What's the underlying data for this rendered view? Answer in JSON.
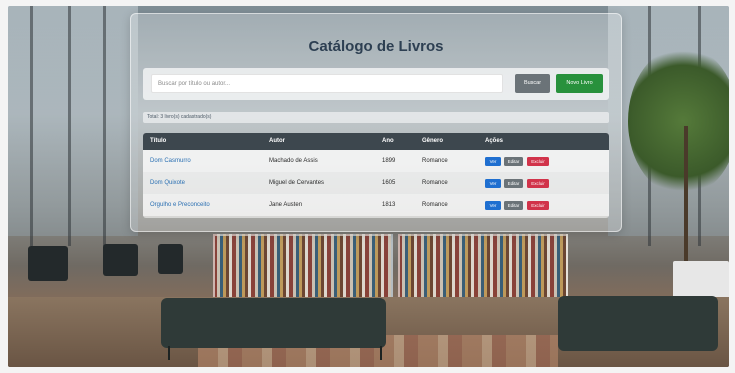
{
  "app": {
    "title": "Catálogo de Livros"
  },
  "search": {
    "placeholder": "Buscar por título ou autor...",
    "buscar_label": "Buscar",
    "novo_label": "Novo Livro"
  },
  "summary": {
    "total_text": "Total: 3 livro(s) cadastrado(s)"
  },
  "table": {
    "headers": [
      "Título",
      "Autor",
      "Ano",
      "Gênero",
      "Ações"
    ],
    "rows": [
      {
        "titulo": "Dom Casmurro",
        "autor": "Machado de Assis",
        "ano": "1899",
        "genero": "Romance"
      },
      {
        "titulo": "Dom Quixote",
        "autor": "Miguel de Cervantes",
        "ano": "1605",
        "genero": "Romance"
      },
      {
        "titulo": "Orgulho e Preconceito",
        "autor": "Jane Austen",
        "ano": "1813",
        "genero": "Romance"
      }
    ],
    "actions": {
      "ver": "Ver",
      "editar": "Editar",
      "excluir": "Excluir"
    }
  },
  "colors": {
    "primary": "#1f6fd0",
    "success": "#28913c",
    "danger": "#d1334a",
    "secondary": "#6b7378",
    "header_bg": "#3d474e",
    "title": "#2d3f52"
  }
}
